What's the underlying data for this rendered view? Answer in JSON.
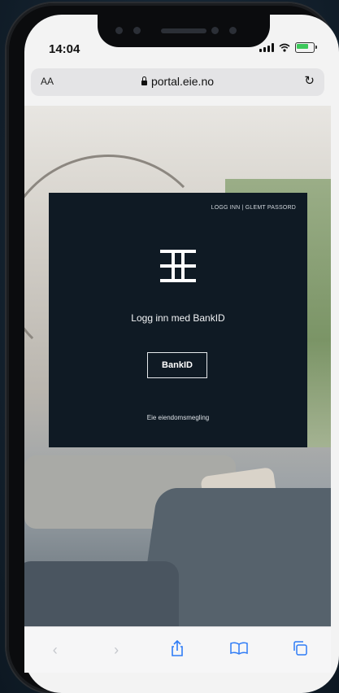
{
  "status_bar": {
    "time": "14:04"
  },
  "browser": {
    "text_size_label": "AA",
    "address": "portal.eie.no",
    "icons": {
      "lock": "lock-icon",
      "reload": "reload-icon"
    }
  },
  "login_card": {
    "top_links": "LOGG INN | GLEMT PASSORD",
    "heading": "Logg inn med BankID",
    "button_label": "BankID",
    "footer": "Eie eiendomsmegling"
  },
  "toolbar": {
    "back_glyph": "‹",
    "forward_glyph": "›",
    "share_glyph": "⇧",
    "bookmarks_glyph": "▯▯",
    "tabs_glyph": "⧉"
  },
  "colors": {
    "card_background": "#0f1a24",
    "page_background": "#14222f",
    "accent": "#2f7cf6"
  }
}
